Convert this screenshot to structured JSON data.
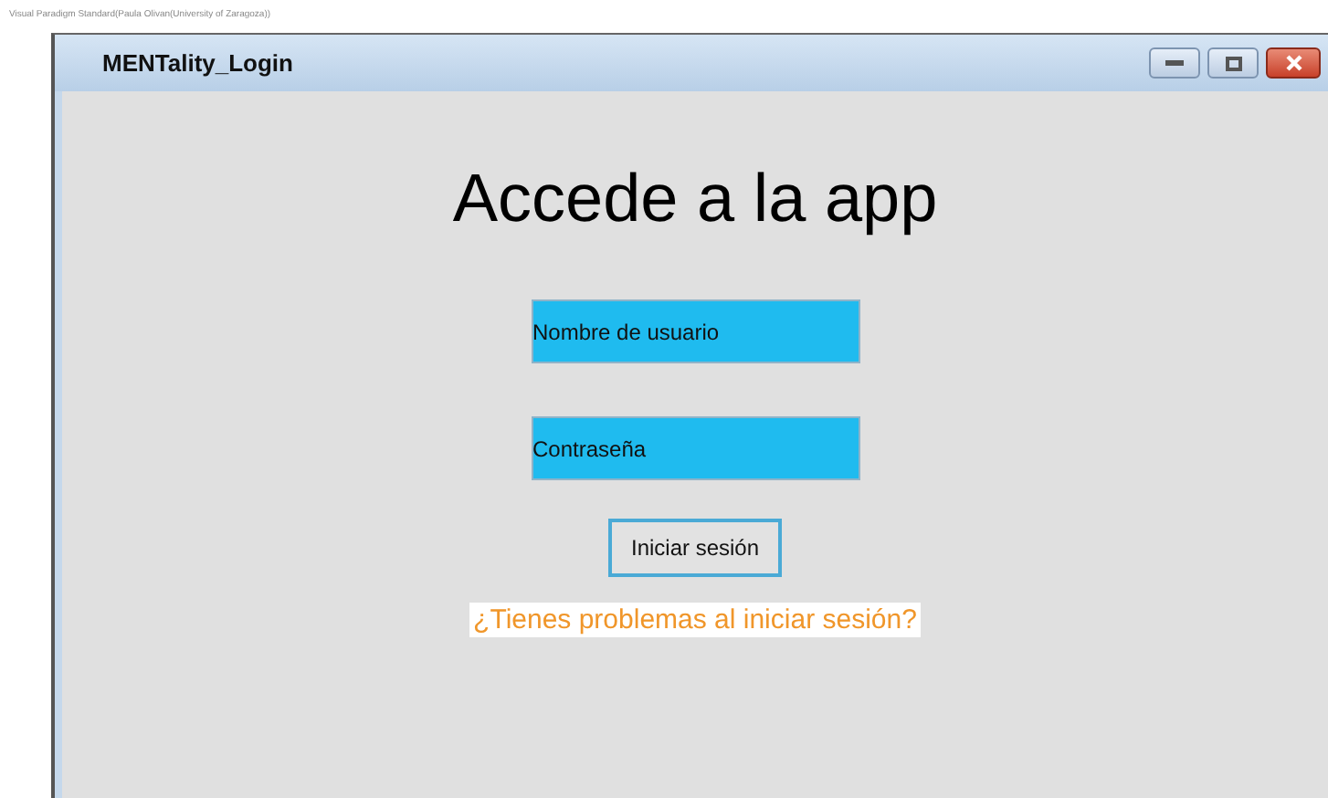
{
  "edition_note": "Visual Paradigm Standard(Paula Olivan(University of Zaragoza))",
  "window": {
    "title": "MENTality_Login"
  },
  "heading": "Accede a la app",
  "fields": [
    {
      "value": "Nombre de usuario"
    },
    {
      "value": "Contraseña"
    }
  ],
  "login_button": "Iniciar sesión",
  "help_link": "¿Tienes problemas al iniciar sesión?"
}
